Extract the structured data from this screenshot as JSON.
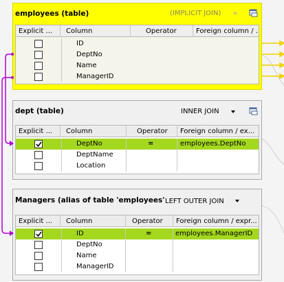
{
  "columns": {
    "explicit": "Explicit ...",
    "column": "Column",
    "operator": "Operator"
  },
  "panels": [
    {
      "title": "employees  (table)",
      "join": "(IMPLICIT JOIN)",
      "foreign_header": "Foreign column / ...",
      "rows": [
        {
          "column": "ID",
          "checked": false,
          "operator": "",
          "foreign": ""
        },
        {
          "column": "DeptNo",
          "checked": false,
          "operator": "",
          "foreign": ""
        },
        {
          "column": "Name",
          "checked": false,
          "operator": "",
          "foreign": ""
        },
        {
          "column": "ManagerID",
          "checked": false,
          "operator": "",
          "foreign": ""
        }
      ]
    },
    {
      "title": "dept  (table)",
      "join": "INNER JOIN",
      "foreign_header": "Foreign column / ex...",
      "rows": [
        {
          "column": "DeptNo",
          "checked": true,
          "operator": "=",
          "foreign": "employees.DeptNo"
        },
        {
          "column": "DeptName",
          "checked": false,
          "operator": "",
          "foreign": ""
        },
        {
          "column": "Location",
          "checked": false,
          "operator": "",
          "foreign": ""
        }
      ]
    },
    {
      "title": "Managers  (alias of table 'employees'",
      "join": "LEFT OUTER JOIN",
      "foreign_header": "Foreign column / expr...",
      "rows": [
        {
          "column": "ID",
          "checked": true,
          "operator": "=",
          "foreign": "employees.ManagerID"
        },
        {
          "column": "DeptNo",
          "checked": false,
          "operator": "",
          "foreign": ""
        },
        {
          "column": "Name",
          "checked": false,
          "operator": "",
          "foreign": ""
        },
        {
          "column": "ManagerID",
          "checked": false,
          "operator": "",
          "foreign": ""
        }
      ]
    }
  ],
  "colors": {
    "employees_header": "#ffff00",
    "selected_row": "#a4d81e",
    "link": "#b000d8",
    "output_link": "#f0d000"
  }
}
